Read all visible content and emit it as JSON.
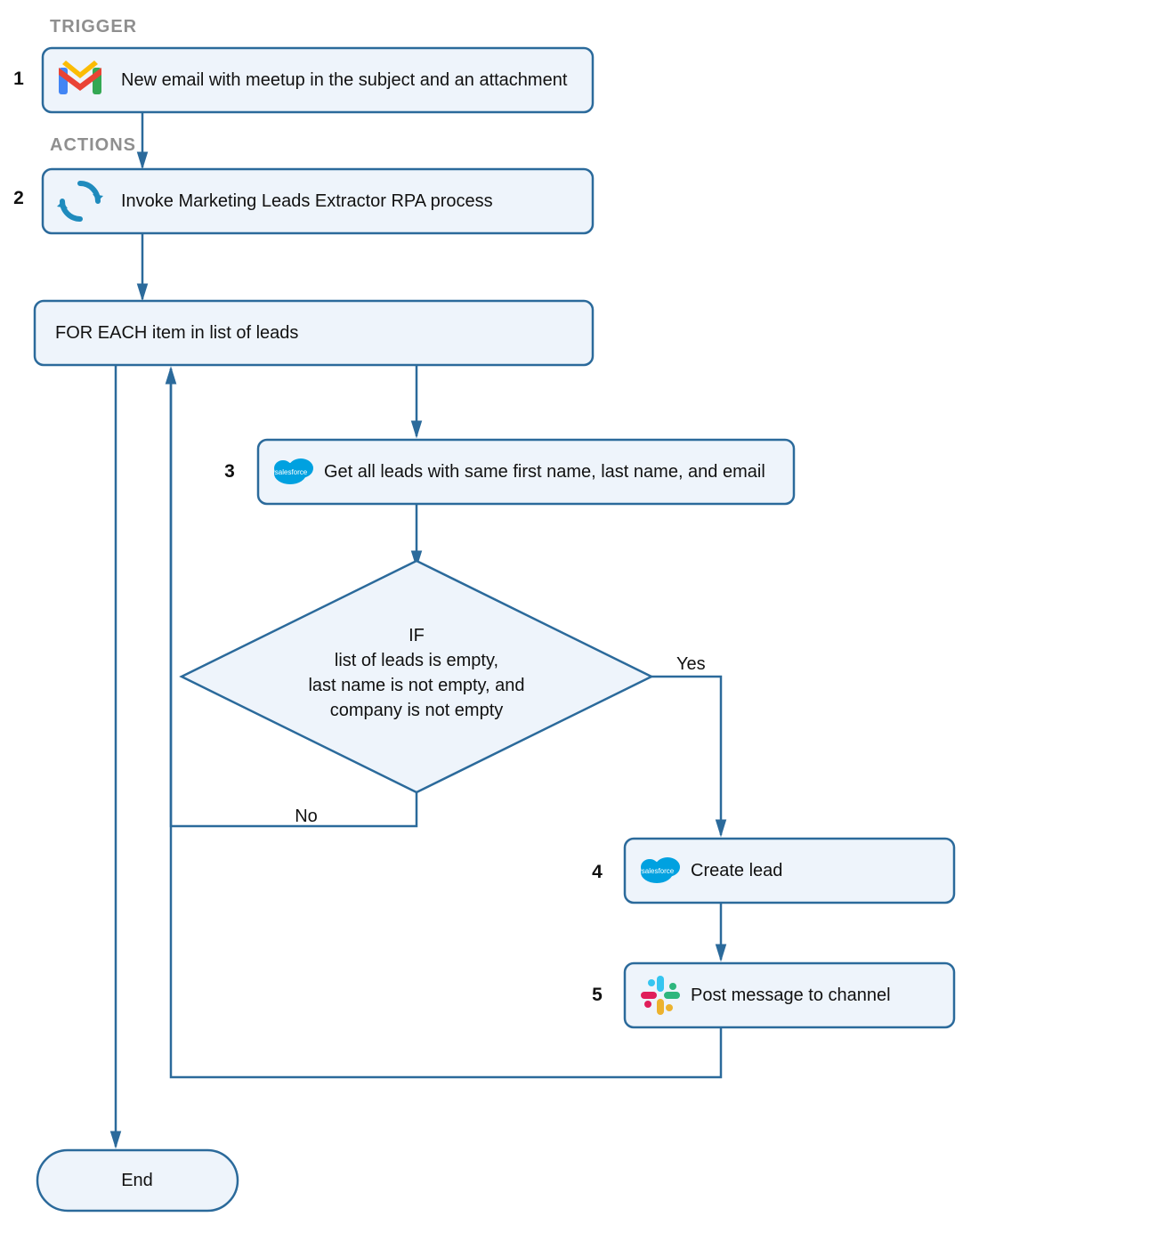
{
  "colors": {
    "stroke": "#2b6a9b",
    "fill": "#eef4fb",
    "section": "#8f8f8f"
  },
  "sections": {
    "trigger": "TRIGGER",
    "actions": "ACTIONS"
  },
  "steps": {
    "s1": {
      "num": "1",
      "label": "New email with meetup in the subject and an attachment",
      "icon": "gmail-icon"
    },
    "s2": {
      "num": "2",
      "label": "Invoke Marketing Leads Extractor RPA process",
      "icon": "rpa-cycle-icon"
    },
    "foreach": {
      "label": "FOR EACH item in list of leads"
    },
    "s3": {
      "num": "3",
      "label": "Get all leads with same first name, last name, and email",
      "icon": "salesforce-icon"
    },
    "decision": {
      "title": "IF",
      "line1": "list of leads is empty,",
      "line2": "last name is not empty, and",
      "line3": "company is not empty"
    },
    "s4": {
      "num": "4",
      "label": "Create lead",
      "icon": "salesforce-icon"
    },
    "s5": {
      "num": "5",
      "label": "Post message to channel",
      "icon": "slack-icon"
    },
    "end": {
      "label": "End"
    }
  },
  "edges": {
    "yes": "Yes",
    "no": "No"
  }
}
